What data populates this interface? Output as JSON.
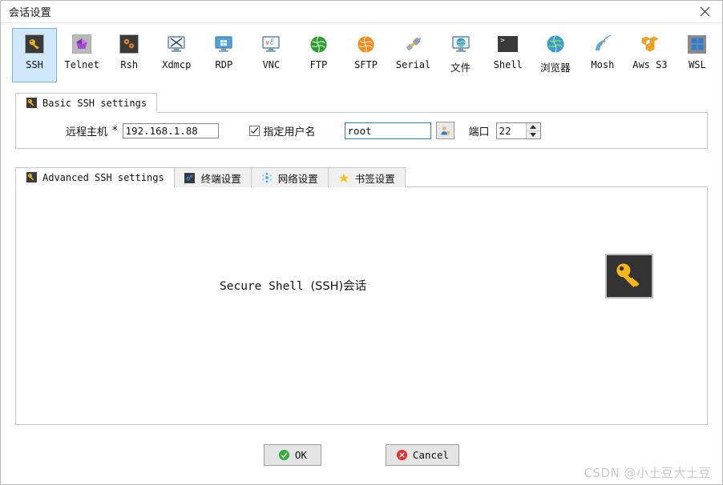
{
  "window": {
    "title": "会话设置",
    "close_label": "✕"
  },
  "protocols": [
    {
      "label": "SSH",
      "icon": "key-icon",
      "selected": true
    },
    {
      "label": "Telnet",
      "icon": "crystal-icon",
      "selected": false
    },
    {
      "label": "Rsh",
      "icon": "gears-icon",
      "selected": false
    },
    {
      "label": "Xdmcp",
      "icon": "monitor-x-icon",
      "selected": false
    },
    {
      "label": "RDP",
      "icon": "windows-monitor-icon",
      "selected": false
    },
    {
      "label": "VNC",
      "icon": "vnc-monitor-icon",
      "selected": false
    },
    {
      "label": "FTP",
      "icon": "green-globe-icon",
      "selected": false
    },
    {
      "label": "SFTP",
      "icon": "orange-globe-icon",
      "selected": false
    },
    {
      "label": "Serial",
      "icon": "plug-icon",
      "selected": false
    },
    {
      "label": "文件",
      "icon": "globe-monitor-icon",
      "selected": false
    },
    {
      "label": "Shell",
      "icon": "terminal-icon",
      "selected": false
    },
    {
      "label": "浏览器",
      "icon": "browser-globe-icon",
      "selected": false
    },
    {
      "label": "Mosh",
      "icon": "satellite-dish-icon",
      "selected": false
    },
    {
      "label": "Aws S3",
      "icon": "aws-cubes-icon",
      "selected": false
    },
    {
      "label": "WSL",
      "icon": "windows-logo-icon",
      "selected": false
    }
  ],
  "basic": {
    "tab_label": "Basic SSH settings",
    "tab_icon": "key-icon",
    "host_label": "远程主机",
    "host_required_mark": "*",
    "host_value": "192.168.1.88",
    "username_checkbox_label": "指定用户名",
    "username_checked": true,
    "username_value": "root",
    "user_button_icon": "user-key-icon",
    "port_label": "端口",
    "port_value": "22"
  },
  "lower_tabs": [
    {
      "label": "Advanced SSH settings",
      "icon": "key-icon",
      "active": false,
      "cjk": false
    },
    {
      "label": "终端设置",
      "icon": "terminal-settings-icon",
      "active": false,
      "cjk": true
    },
    {
      "label": "网络设置",
      "icon": "network-icon",
      "active": false,
      "cjk": true
    },
    {
      "label": "书签设置",
      "icon": "star-icon",
      "active": false,
      "cjk": true
    }
  ],
  "content": {
    "caption_ascii": "Secure Shell ",
    "caption_cjk": "(SSH)会话",
    "big_icon": "key-icon"
  },
  "footer": {
    "ok_label": "OK",
    "cancel_label": "Cancel",
    "ok_icon": "green-check-icon",
    "cancel_icon": "red-x-icon",
    "watermark": "CSDN @小土豆大土豆"
  },
  "colors": {
    "selection_bg": "#cfe8fb",
    "selection_border": "#7ab3dd",
    "focus_border": "#2f7fd0",
    "panel_border": "#c8c8c8",
    "ok_green": "#3aab3a",
    "cancel_red": "#e03131",
    "key_yellow": "#f5b521",
    "watermark_gray": "#c9c9c9"
  }
}
